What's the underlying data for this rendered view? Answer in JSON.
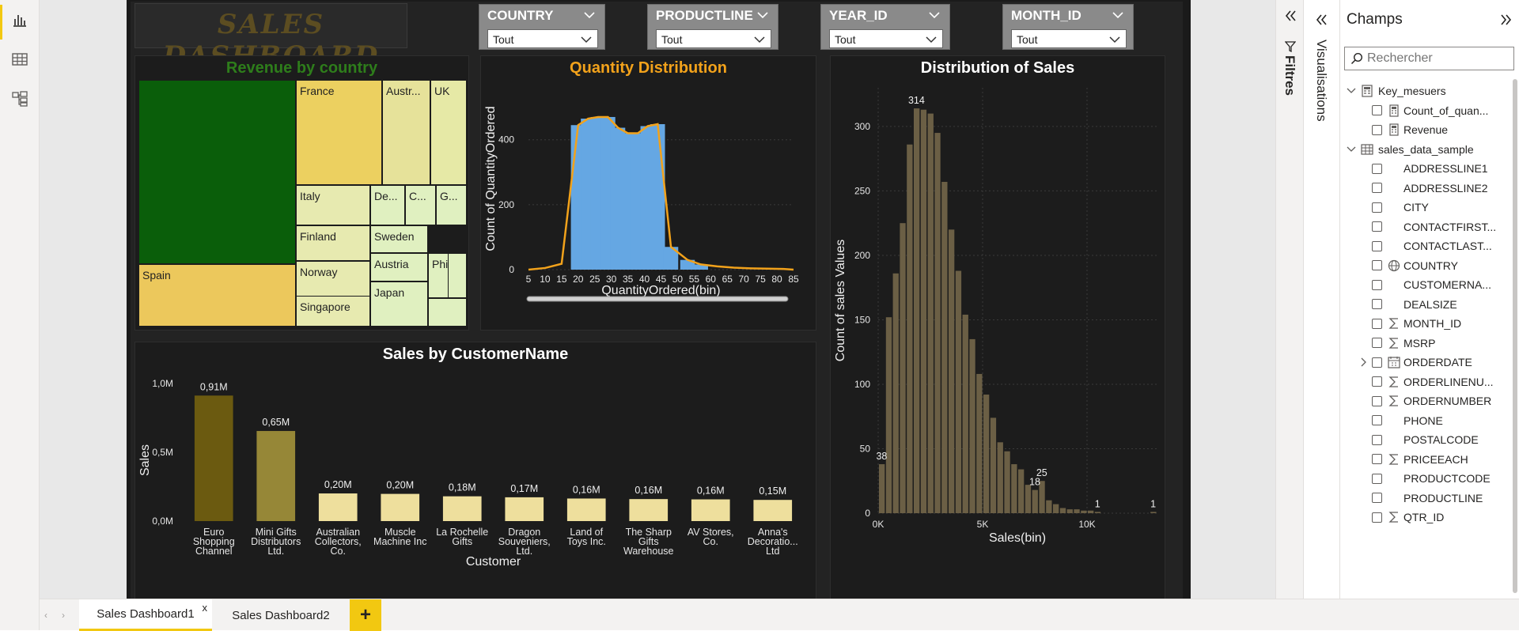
{
  "left_nav": {
    "items": [
      {
        "icon": "report-view-icon"
      },
      {
        "icon": "data-view-icon"
      },
      {
        "icon": "model-view-icon"
      }
    ],
    "accent": "#f2c811"
  },
  "dashboard": {
    "title": "SALES DASHBOARD",
    "title_color": "#5c4d21",
    "background": "#232323",
    "slicers": [
      {
        "label": "COUNTRY",
        "value": "Tout"
      },
      {
        "label": "PRODUCTLINE",
        "value": "Tout"
      },
      {
        "label": "YEAR_ID",
        "value": "Tout"
      },
      {
        "label": "MONTH_ID",
        "value": "Tout"
      }
    ]
  },
  "treemap": {
    "title": "Revenue by country",
    "title_color": "#2e7d1b",
    "cells": [
      {
        "label": "",
        "color": "#0a5e0a"
      },
      {
        "label": "France",
        "color": "#ecd060"
      },
      {
        "label": "Austr...",
        "color": "#e6e29a"
      },
      {
        "label": "UK",
        "color": "#e6e9a6"
      },
      {
        "label": "Spain",
        "color": "#ecc85c"
      },
      {
        "label": "Italy",
        "color": "#e7eab0"
      },
      {
        "label": "De...",
        "color": "#e0f0c0"
      },
      {
        "label": "C...",
        "color": "#e0f0c0"
      },
      {
        "label": "G...",
        "color": "#e0f0c0"
      },
      {
        "label": "Finland",
        "color": "#e7eab0"
      },
      {
        "label": "Sweden",
        "color": "#e0f0c0"
      },
      {
        "label": "Norway",
        "color": "#e7eab0"
      },
      {
        "label": "Austria",
        "color": "#e0f0c0"
      },
      {
        "label": "Singapore",
        "color": "#e7eab0"
      },
      {
        "label": "Japan",
        "color": "#e0f0c0"
      },
      {
        "label": "Phi...",
        "color": "#e0f0c0"
      },
      {
        "label": "",
        "color": "#e0f0c0"
      },
      {
        "label": "",
        "color": "#e0f0c0"
      }
    ]
  },
  "chart_data": [
    {
      "type": "bar",
      "title": "Quantity Distribution",
      "title_color": "#f2a21b",
      "xlabel": "QuantityOrdered(bin)",
      "ylabel": "Count of QuantityOrdered",
      "categories": [
        "5",
        "10",
        "15",
        "20",
        "25",
        "30",
        "35",
        "40",
        "45",
        "50",
        "55",
        "60",
        "65",
        "70",
        "75",
        "80",
        "85"
      ],
      "x_ticks": [
        "5",
        "10",
        "15",
        "20",
        "25",
        "30",
        "35",
        "40",
        "45",
        "50",
        "55",
        "60",
        "65",
        "70",
        "75",
        "80",
        "85"
      ],
      "y_ticks": [
        "0",
        "200",
        "400"
      ],
      "ylim": [
        0,
        560
      ],
      "bar_color": "#65a7e3",
      "line_color": "#f2a21b",
      "bars": [
        {
          "x": 20,
          "y": 445
        },
        {
          "x": 23,
          "y": 465
        },
        {
          "x": 26,
          "y": 470
        },
        {
          "x": 29,
          "y": 470
        },
        {
          "x": 32,
          "y": 437
        },
        {
          "x": 35,
          "y": 420
        },
        {
          "x": 38,
          "y": 420
        },
        {
          "x": 41,
          "y": 442
        },
        {
          "x": 44,
          "y": 448
        },
        {
          "x": 48,
          "y": 70
        },
        {
          "x": 53,
          "y": 30
        },
        {
          "x": 57,
          "y": 16
        }
      ],
      "line": [
        {
          "x": 5,
          "y": 0
        },
        {
          "x": 10,
          "y": 5
        },
        {
          "x": 15,
          "y": 18
        },
        {
          "x": 20,
          "y": 445
        },
        {
          "x": 23,
          "y": 465
        },
        {
          "x": 26,
          "y": 470
        },
        {
          "x": 29,
          "y": 470
        },
        {
          "x": 32,
          "y": 437
        },
        {
          "x": 35,
          "y": 420
        },
        {
          "x": 38,
          "y": 420
        },
        {
          "x": 41,
          "y": 442
        },
        {
          "x": 44,
          "y": 448
        },
        {
          "x": 48,
          "y": 70
        },
        {
          "x": 53,
          "y": 30
        },
        {
          "x": 57,
          "y": 16
        },
        {
          "x": 62,
          "y": 10
        },
        {
          "x": 67,
          "y": 6
        },
        {
          "x": 72,
          "y": 4
        },
        {
          "x": 77,
          "y": 3
        },
        {
          "x": 82,
          "y": 2
        },
        {
          "x": 85,
          "y": 0
        }
      ]
    },
    {
      "type": "bar",
      "title": "Distribution of Sales",
      "title_color": "#ffffff",
      "xlabel": "Sales(bin)",
      "ylabel": "Count of sales Values",
      "ylim": [
        0,
        330
      ],
      "x_ticks": [
        "0K",
        "5K",
        "10K"
      ],
      "y_ticks": [
        "0",
        "50",
        "100",
        "150",
        "200",
        "250",
        "300"
      ],
      "bar_color": "#6b5f45",
      "values": [
        38,
        152,
        186,
        225,
        286,
        314,
        313,
        310,
        295,
        257,
        220,
        188,
        154,
        135,
        108,
        92,
        74,
        55,
        48,
        38,
        34,
        22,
        18,
        25,
        10,
        7,
        4,
        3,
        3,
        2,
        2,
        1,
        0,
        0,
        0,
        0,
        0,
        0,
        0,
        1
      ],
      "labels": [
        {
          "index": 0,
          "text": "38"
        },
        {
          "index": 5,
          "text": "314"
        },
        {
          "index": 22,
          "text": "18"
        },
        {
          "index": 23,
          "text": "25"
        },
        {
          "index": 31,
          "text": "1"
        },
        {
          "index": 39,
          "text": "1"
        }
      ]
    },
    {
      "type": "bar",
      "title": "Sales by CustomerName",
      "title_color": "#ffffff",
      "xlabel": "Customer",
      "ylabel": "Sales",
      "ylim": [
        0,
        1000000
      ],
      "y_ticks": [
        "0,0M",
        "0,5M",
        "1,0M"
      ],
      "categories": [
        "Euro Shopping Channel",
        "Mini Gifts Distributors Ltd.",
        "Australian Collectors, Co.",
        "Muscle Machine Inc",
        "La Rochelle Gifts",
        "Dragon Souveniers, Ltd.",
        "Land of Toys Inc.",
        "The Sharp Gifts Warehouse",
        "AV Stores, Co.",
        "Anna's Decoratio... Ltd"
      ],
      "category_lines": [
        [
          "Euro",
          "Shopping",
          "Channel"
        ],
        [
          "Mini Gifts",
          "Distributors",
          "Ltd."
        ],
        [
          "Australian",
          "Collectors,",
          "Co."
        ],
        [
          "Muscle",
          "Machine Inc"
        ],
        [
          "La Rochelle",
          "Gifts"
        ],
        [
          "Dragon",
          "Souveniers,",
          "Ltd."
        ],
        [
          "Land of",
          "Toys Inc."
        ],
        [
          "The Sharp",
          "Gifts",
          "Warehouse"
        ],
        [
          "AV Stores,",
          "Co."
        ],
        [
          "Anna's",
          "Decoratio...",
          "Ltd"
        ]
      ],
      "values": [
        912294,
        654858,
        200995,
        197737,
        180125,
        172990,
        164069,
        160010,
        157808,
        153996
      ],
      "value_labels": [
        "0,91M",
        "0,65M",
        "0,20M",
        "0,20M",
        "0,18M",
        "0,17M",
        "0,16M",
        "0,16M",
        "0,16M",
        "0,15M"
      ],
      "bar_colors": [
        "#6b5a10",
        "#968737",
        "#eedf9d",
        "#eedf9d",
        "#eedf9d",
        "#eedf9d",
        "#eedf9d",
        "#eedf9d",
        "#eedf9d",
        "#eedf9d"
      ]
    }
  ],
  "panes": {
    "filters_label": "Filtres",
    "visualizations_label": "Visualisations",
    "fields": {
      "title": "Champs",
      "search_placeholder": "Rechercher",
      "tables": [
        {
          "name": "Key_mesuers",
          "icon": "calculator-table-icon",
          "items": [
            {
              "label": "Count_of_quan...",
              "icon": "calculator-icon"
            },
            {
              "label": "Revenue",
              "icon": "calculator-icon"
            }
          ]
        },
        {
          "name": "sales_data_sample",
          "icon": "table-icon",
          "items": [
            {
              "label": "ADDRESSLINE1",
              "icon": ""
            },
            {
              "label": "ADDRESSLINE2",
              "icon": ""
            },
            {
              "label": "CITY",
              "icon": ""
            },
            {
              "label": "CONTACTFIRST...",
              "icon": ""
            },
            {
              "label": "CONTACTLAST...",
              "icon": ""
            },
            {
              "label": "COUNTRY",
              "icon": "globe-icon"
            },
            {
              "label": "CUSTOMERNA...",
              "icon": ""
            },
            {
              "label": "DEALSIZE",
              "icon": ""
            },
            {
              "label": "MONTH_ID",
              "icon": "sigma-icon"
            },
            {
              "label": "MSRP",
              "icon": "sigma-icon"
            },
            {
              "label": "ORDERDATE",
              "icon": "calendar-icon"
            },
            {
              "label": "ORDERLINENU...",
              "icon": "sigma-icon"
            },
            {
              "label": "ORDERNUMBER",
              "icon": "sigma-icon"
            },
            {
              "label": "PHONE",
              "icon": ""
            },
            {
              "label": "POSTALCODE",
              "icon": ""
            },
            {
              "label": "PRICEEACH",
              "icon": "sigma-icon"
            },
            {
              "label": "PRODUCTCODE",
              "icon": ""
            },
            {
              "label": "PRODUCTLINE",
              "icon": ""
            },
            {
              "label": "QTR_ID",
              "icon": "sigma-icon"
            }
          ]
        }
      ]
    }
  },
  "tabs": {
    "items": [
      {
        "label": "Sales Dashboard1",
        "active": true,
        "close": "x"
      },
      {
        "label": "Sales Dashboard2",
        "active": false
      }
    ],
    "add_label": "+"
  }
}
